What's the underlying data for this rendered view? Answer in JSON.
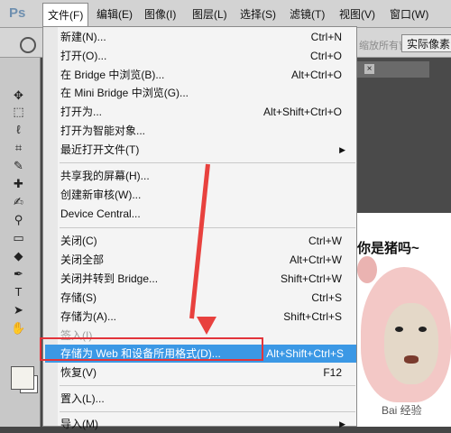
{
  "app": {
    "logo": "Ps"
  },
  "menubar": {
    "items": [
      "文件(F)",
      "编辑(E)",
      "图像(I)",
      "图层(L)",
      "选择(S)",
      "滤镜(T)",
      "视图(V)",
      "窗口(W)"
    ]
  },
  "options_bar": {
    "fit_button": "实际像素",
    "gray_label": "缩放所有窗口"
  },
  "file_menu": {
    "items": [
      {
        "label": "新建(N)...",
        "shortcut": "Ctrl+N"
      },
      {
        "label": "打开(O)...",
        "shortcut": "Ctrl+O"
      },
      {
        "label": "在 Bridge 中浏览(B)...",
        "shortcut": "Alt+Ctrl+O"
      },
      {
        "label": "在 Mini Bridge 中浏览(G)...",
        "shortcut": ""
      },
      {
        "label": "打开为...",
        "shortcut": "Alt+Shift+Ctrl+O"
      },
      {
        "label": "打开为智能对象...",
        "shortcut": ""
      },
      {
        "label": "最近打开文件(T)",
        "shortcut": ""
      },
      {
        "label": "共享我的屏幕(H)...",
        "shortcut": ""
      },
      {
        "label": "创建新审核(W)...",
        "shortcut": ""
      },
      {
        "label": "Device Central...",
        "shortcut": ""
      },
      {
        "label": "关闭(C)",
        "shortcut": "Ctrl+W"
      },
      {
        "label": "关闭全部",
        "shortcut": "Alt+Ctrl+W"
      },
      {
        "label": "关闭并转到 Bridge...",
        "shortcut": "Shift+Ctrl+W"
      },
      {
        "label": "存储(S)",
        "shortcut": "Ctrl+S"
      },
      {
        "label": "存储为(A)...",
        "shortcut": "Shift+Ctrl+S"
      },
      {
        "label": "签入(I)...",
        "shortcut": ""
      },
      {
        "label": "存储为 Web 和设备所用格式(D)...",
        "shortcut": "Alt+Shift+Ctrl+S"
      },
      {
        "label": "恢复(V)",
        "shortcut": "F12"
      },
      {
        "label": "置入(L)...",
        "shortcut": ""
      },
      {
        "label": "导入(M)",
        "shortcut": ""
      }
    ]
  },
  "image": {
    "caption": "你是猪吗~",
    "watermark": "Bai 经验"
  },
  "colors": {
    "highlight": "#3b98e5",
    "annotation_red": "#e8413e"
  }
}
